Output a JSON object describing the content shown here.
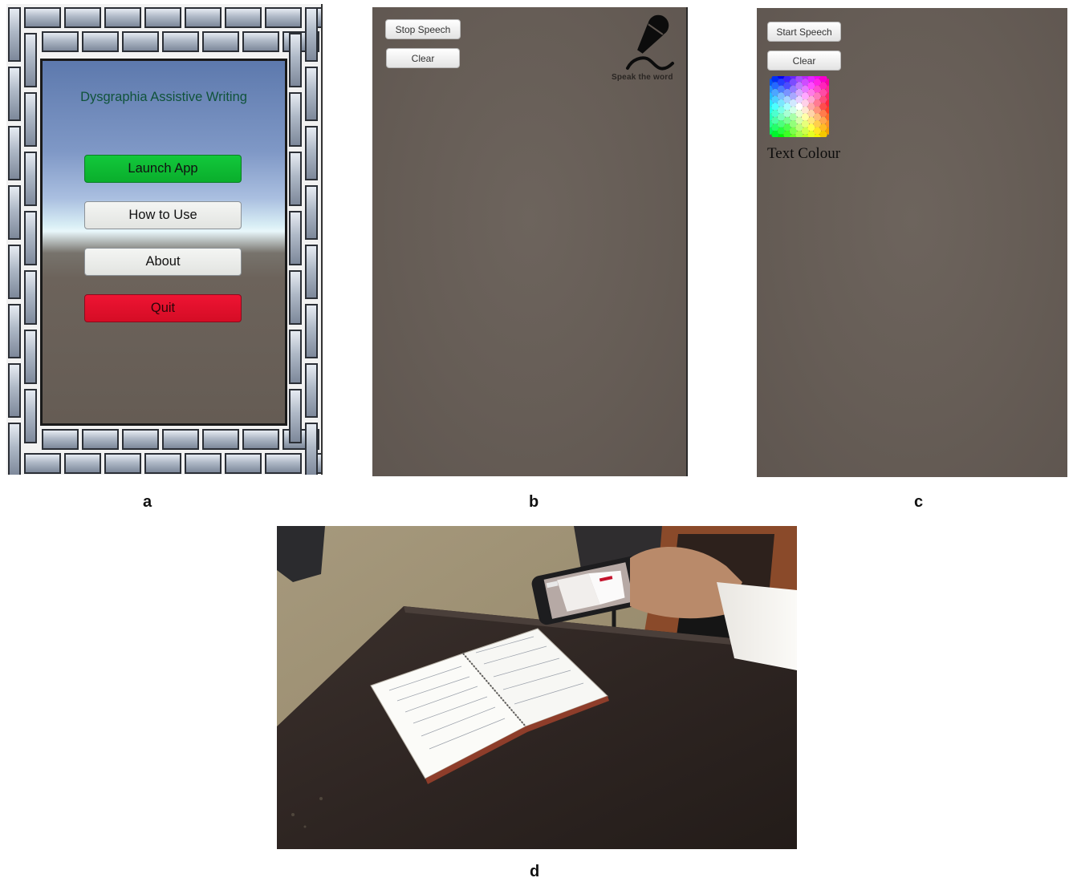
{
  "panel_a": {
    "app_title": "Dysgraphia Assistive Writing",
    "buttons": {
      "launch": "Launch App",
      "how_to_use": "How to Use",
      "about": "About",
      "quit": "Quit"
    },
    "colors": {
      "launch": "#0aba30",
      "quit": "#e1102b",
      "title": "#10533a"
    }
  },
  "panel_b": {
    "stop_speech": "Stop Speech",
    "clear": "Clear",
    "speak_caption": "Speak the word",
    "icon": "microphone-icon"
  },
  "panel_c": {
    "start_speech": "Start Speech",
    "clear": "Clear",
    "text_colour": "Text Colour",
    "icon": "color-palette-icon"
  },
  "panel_d": {
    "description_icon": "photo-phone-notebook"
  },
  "labels": {
    "a": "a",
    "b": "b",
    "c": "c",
    "d": "d"
  }
}
